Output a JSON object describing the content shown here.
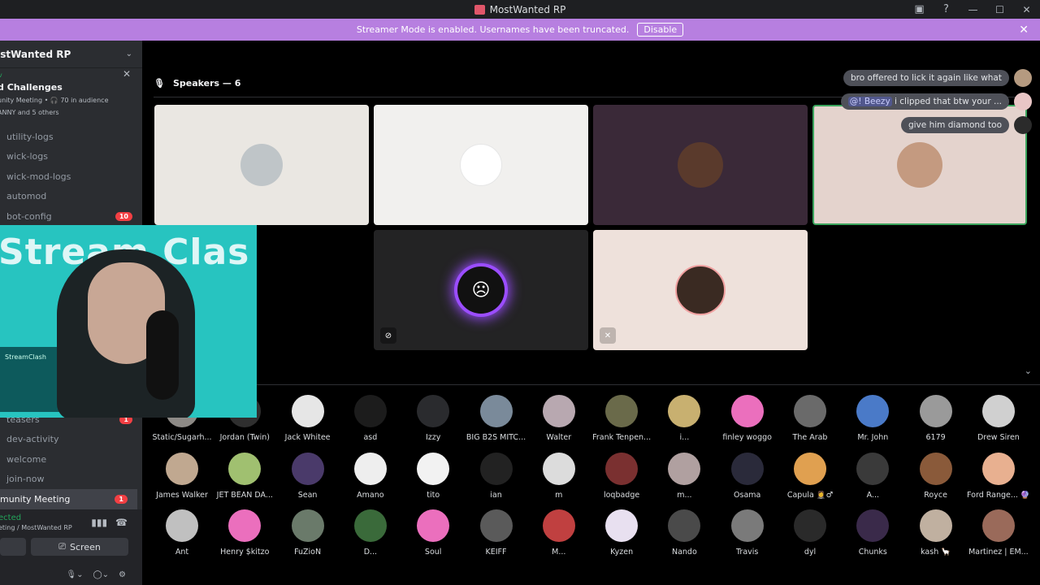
{
  "window": {
    "title": "MostWanted RP"
  },
  "banner": {
    "message": "Streamer Mode is enabled. Usernames have been truncated.",
    "disable_label": "Disable"
  },
  "sidebar": {
    "server_name": "ostWanted RP",
    "event": {
      "live_label": "v",
      "title": "d Challenges",
      "subtitle": "unity Meeting • 🎧 70 in audience",
      "who": "ANNY and 5 others"
    },
    "channels_top": [
      {
        "label": "utility-logs",
        "badge": ""
      },
      {
        "label": "wick-logs",
        "badge": ""
      },
      {
        "label": "wick-mod-logs",
        "badge": ""
      },
      {
        "label": "automod",
        "badge": ""
      },
      {
        "label": "bot-config",
        "badge": "10"
      }
    ],
    "channels_bottom": [
      {
        "label": "teasers",
        "badge": "1"
      },
      {
        "label": "dev-activity",
        "badge": ""
      },
      {
        "label": "welcome",
        "badge": ""
      },
      {
        "label": "join-now",
        "badge": ""
      }
    ],
    "active_channel": {
      "label": "munity Meeting",
      "badge": "1"
    },
    "voice": {
      "status": "ected",
      "where": "eting / MostWanted RP",
      "screen_label": "Screen"
    }
  },
  "stage": {
    "speakers_label": "Speakers — 6"
  },
  "chat": [
    {
      "text": "bro offered to lick it again like what"
    },
    {
      "mention": "@! Beezy",
      "text": "i clipped that btw your ..."
    },
    {
      "text": "give him diamond too"
    }
  ],
  "webcam": {
    "brand_text": "Stream Clas",
    "monitor_text": "StreamClash"
  },
  "audience": [
    [
      "Static/Sugarh...",
      "Jordan (Twin)",
      "Jack Whitee",
      "asd",
      "Izzy",
      "BIG B2S MITC...",
      "Walter",
      "Frank Tenpen...",
      "i...",
      "finley woggo",
      "The Arab",
      "Mr. John",
      "6179",
      "Drew Siren"
    ],
    [
      "James Walker",
      "JET BEAN DA...",
      "Sean",
      "Amano",
      "tito",
      "ian",
      "m",
      "loqbadge",
      "m...",
      "Osama",
      "Capula 🤵‍♀️♂",
      "A...",
      "Royce",
      "Ford Range... 🔮"
    ],
    [
      "Ant",
      "Henry $kitzo",
      "FuZioN",
      "D...",
      "Soul",
      "KEIFF",
      "M...",
      "Kyzen",
      "Nando",
      "Travis",
      "dyl",
      "Chunks",
      "kash 🦙",
      "Martinez | EM..."
    ]
  ],
  "colors": {
    "accent_purple": "#b77fe0",
    "speaking_ring": "#9b4dff",
    "highlight_border": "#3ba55d",
    "badge_red": "#f23f43",
    "discord_pink": "#eb6fbd"
  }
}
